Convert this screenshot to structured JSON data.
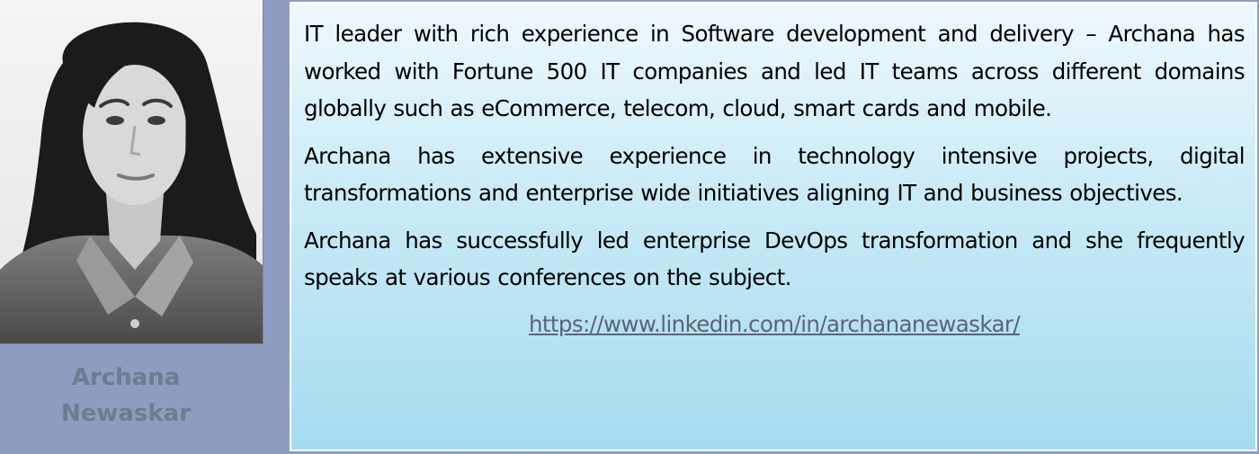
{
  "profile": {
    "name_first": "Archana",
    "name_last": "Newaskar",
    "colors": {
      "sidebar_background": "#8e9dbf",
      "name_text": "#6d7c8e",
      "panel_gradient_top": "#eef8fd",
      "panel_gradient_bottom": "#a5dbef",
      "link_text": "#5b6476"
    }
  },
  "bio": {
    "paragraphs": [
      "IT leader with rich experience in Software development and delivery – Archana has worked with Fortune 500 IT companies and led IT teams across different domains globally such as eCommerce, telecom, cloud, smart cards and mobile.",
      "Archana has extensive experience in technology intensive projects, digital transformations and enterprise wide initiatives aligning IT and business objectives.",
      "Archana has successfully led enterprise DevOps transformation and she frequently speaks at various conferences on the subject."
    ],
    "link_url": "https://www.linkedin.com/in/archananewaskar/"
  }
}
